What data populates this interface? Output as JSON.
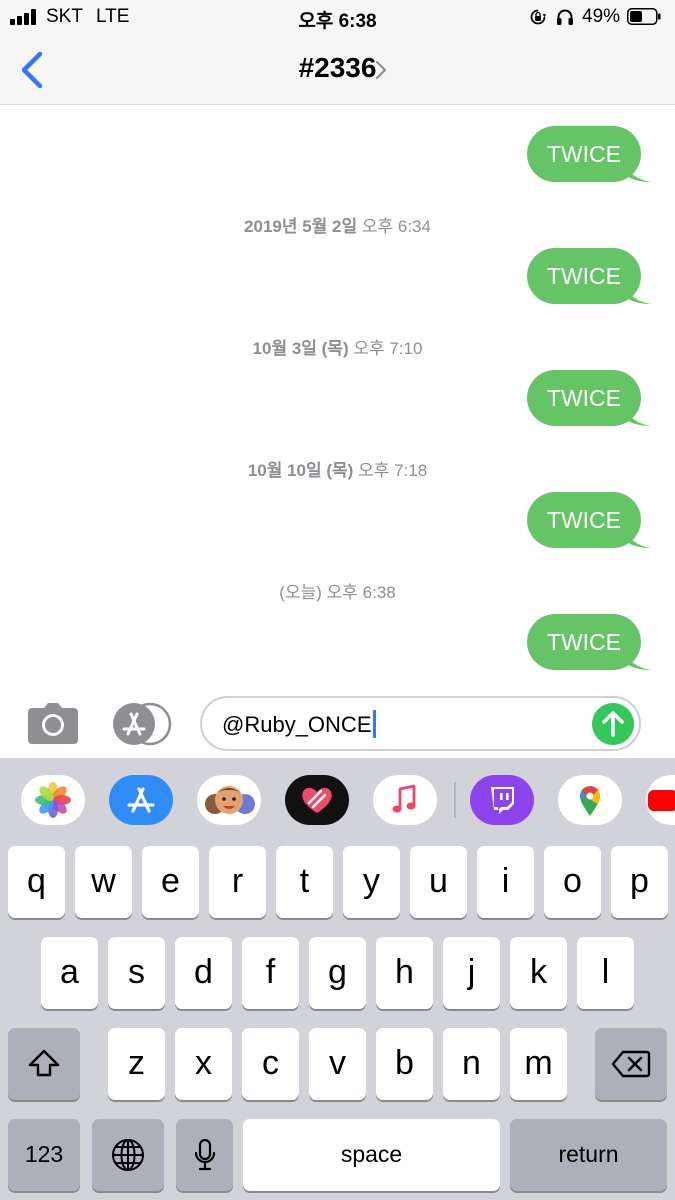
{
  "status_bar": {
    "carrier": "SKT",
    "network": "LTE",
    "time": "오후 6:38",
    "battery_percent": "49%",
    "battery_level": 0.49,
    "icons": [
      "signal-icon",
      "rotation-lock-icon",
      "headphones-icon",
      "battery-icon"
    ]
  },
  "nav": {
    "back_icon": "chevron-left-icon",
    "title": "#2336",
    "title_icon": "chevron-right-icon"
  },
  "conversation": {
    "timestamps": [
      {
        "date": "2019년 5월 2일",
        "time": "오후 6:34"
      },
      {
        "date": "10월 3일 (목)",
        "time": "오후 7:10"
      },
      {
        "date": "10월 10일 (목)",
        "time": "오후 7:18"
      },
      {
        "date": "(오늘)",
        "time": "오후 6:38"
      }
    ],
    "messages": [
      "TWICE",
      "TWICE",
      "TWICE",
      "TWICE",
      "TWICE"
    ]
  },
  "input": {
    "camera_icon": "camera-icon",
    "appstore_icon": "app-store-icon",
    "message_value": "@Ruby_ONCE",
    "send_icon": "arrow-up-icon"
  },
  "app_drawer": {
    "apps": [
      "photos-icon",
      "app-store-icon",
      "memoji-icon",
      "digital-touch-icon",
      "music-icon",
      "twitch-icon",
      "google-maps-icon",
      "youtube-icon"
    ]
  },
  "keyboard": {
    "row1": [
      "q",
      "w",
      "e",
      "r",
      "t",
      "y",
      "u",
      "i",
      "o",
      "p"
    ],
    "row2": [
      "a",
      "s",
      "d",
      "f",
      "g",
      "h",
      "j",
      "k",
      "l"
    ],
    "row3": [
      "z",
      "x",
      "c",
      "v",
      "b",
      "n",
      "m"
    ],
    "numbers_key": "123",
    "space_key": "space",
    "return_key": "return",
    "shift_icon": "shift-icon",
    "delete_icon": "delete-icon",
    "globe_icon": "globe-icon",
    "mic_icon": "microphone-icon"
  },
  "colors": {
    "bubble": "#65c466",
    "send": "#34c759",
    "link": "#3478f6",
    "timestamp": "#8e8e93"
  }
}
